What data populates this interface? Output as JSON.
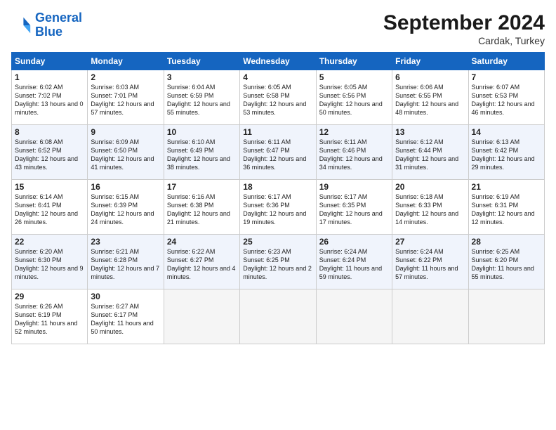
{
  "logo": {
    "line1": "General",
    "line2": "Blue"
  },
  "title": "September 2024",
  "location": "Cardak, Turkey",
  "days_of_week": [
    "Sunday",
    "Monday",
    "Tuesday",
    "Wednesday",
    "Thursday",
    "Friday",
    "Saturday"
  ],
  "weeks": [
    [
      {
        "day": "1",
        "sunrise": "6:02 AM",
        "sunset": "7:02 PM",
        "daylight": "13 hours and 0 minutes."
      },
      {
        "day": "2",
        "sunrise": "6:03 AM",
        "sunset": "7:01 PM",
        "daylight": "12 hours and 57 minutes."
      },
      {
        "day": "3",
        "sunrise": "6:04 AM",
        "sunset": "6:59 PM",
        "daylight": "12 hours and 55 minutes."
      },
      {
        "day": "4",
        "sunrise": "6:05 AM",
        "sunset": "6:58 PM",
        "daylight": "12 hours and 53 minutes."
      },
      {
        "day": "5",
        "sunrise": "6:05 AM",
        "sunset": "6:56 PM",
        "daylight": "12 hours and 50 minutes."
      },
      {
        "day": "6",
        "sunrise": "6:06 AM",
        "sunset": "6:55 PM",
        "daylight": "12 hours and 48 minutes."
      },
      {
        "day": "7",
        "sunrise": "6:07 AM",
        "sunset": "6:53 PM",
        "daylight": "12 hours and 46 minutes."
      }
    ],
    [
      {
        "day": "8",
        "sunrise": "6:08 AM",
        "sunset": "6:52 PM",
        "daylight": "12 hours and 43 minutes."
      },
      {
        "day": "9",
        "sunrise": "6:09 AM",
        "sunset": "6:50 PM",
        "daylight": "12 hours and 41 minutes."
      },
      {
        "day": "10",
        "sunrise": "6:10 AM",
        "sunset": "6:49 PM",
        "daylight": "12 hours and 38 minutes."
      },
      {
        "day": "11",
        "sunrise": "6:11 AM",
        "sunset": "6:47 PM",
        "daylight": "12 hours and 36 minutes."
      },
      {
        "day": "12",
        "sunrise": "6:11 AM",
        "sunset": "6:46 PM",
        "daylight": "12 hours and 34 minutes."
      },
      {
        "day": "13",
        "sunrise": "6:12 AM",
        "sunset": "6:44 PM",
        "daylight": "12 hours and 31 minutes."
      },
      {
        "day": "14",
        "sunrise": "6:13 AM",
        "sunset": "6:42 PM",
        "daylight": "12 hours and 29 minutes."
      }
    ],
    [
      {
        "day": "15",
        "sunrise": "6:14 AM",
        "sunset": "6:41 PM",
        "daylight": "12 hours and 26 minutes."
      },
      {
        "day": "16",
        "sunrise": "6:15 AM",
        "sunset": "6:39 PM",
        "daylight": "12 hours and 24 minutes."
      },
      {
        "day": "17",
        "sunrise": "6:16 AM",
        "sunset": "6:38 PM",
        "daylight": "12 hours and 21 minutes."
      },
      {
        "day": "18",
        "sunrise": "6:17 AM",
        "sunset": "6:36 PM",
        "daylight": "12 hours and 19 minutes."
      },
      {
        "day": "19",
        "sunrise": "6:17 AM",
        "sunset": "6:35 PM",
        "daylight": "12 hours and 17 minutes."
      },
      {
        "day": "20",
        "sunrise": "6:18 AM",
        "sunset": "6:33 PM",
        "daylight": "12 hours and 14 minutes."
      },
      {
        "day": "21",
        "sunrise": "6:19 AM",
        "sunset": "6:31 PM",
        "daylight": "12 hours and 12 minutes."
      }
    ],
    [
      {
        "day": "22",
        "sunrise": "6:20 AM",
        "sunset": "6:30 PM",
        "daylight": "12 hours and 9 minutes."
      },
      {
        "day": "23",
        "sunrise": "6:21 AM",
        "sunset": "6:28 PM",
        "daylight": "12 hours and 7 minutes."
      },
      {
        "day": "24",
        "sunrise": "6:22 AM",
        "sunset": "6:27 PM",
        "daylight": "12 hours and 4 minutes."
      },
      {
        "day": "25",
        "sunrise": "6:23 AM",
        "sunset": "6:25 PM",
        "daylight": "12 hours and 2 minutes."
      },
      {
        "day": "26",
        "sunrise": "6:24 AM",
        "sunset": "6:24 PM",
        "daylight": "11 hours and 59 minutes."
      },
      {
        "day": "27",
        "sunrise": "6:24 AM",
        "sunset": "6:22 PM",
        "daylight": "11 hours and 57 minutes."
      },
      {
        "day": "28",
        "sunrise": "6:25 AM",
        "sunset": "6:20 PM",
        "daylight": "11 hours and 55 minutes."
      }
    ],
    [
      {
        "day": "29",
        "sunrise": "6:26 AM",
        "sunset": "6:19 PM",
        "daylight": "11 hours and 52 minutes."
      },
      {
        "day": "30",
        "sunrise": "6:27 AM",
        "sunset": "6:17 PM",
        "daylight": "11 hours and 50 minutes."
      },
      null,
      null,
      null,
      null,
      null
    ]
  ]
}
